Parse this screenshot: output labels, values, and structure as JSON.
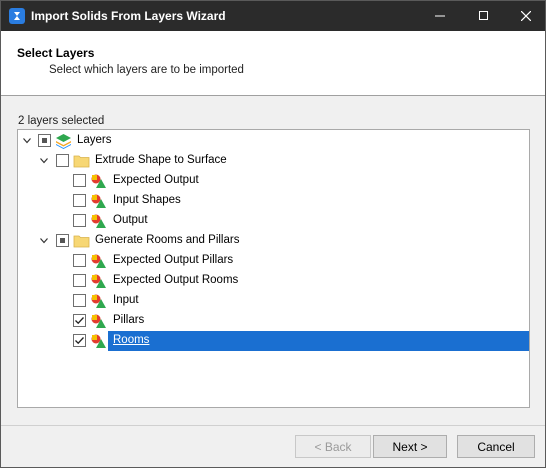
{
  "window": {
    "title": "Import Solids From Layers Wizard"
  },
  "header": {
    "title": "Select Layers",
    "subtitle": "Select which layers are to be imported"
  },
  "selection_count": "2 layers selected",
  "tree": {
    "root": {
      "label": "Layers",
      "state": "indeterminate",
      "expanded": true
    },
    "groups": [
      {
        "label": "Extrude Shape to Surface",
        "state": "unchecked",
        "expanded": true,
        "children": [
          {
            "label": "Expected Output",
            "checked": false
          },
          {
            "label": "Input Shapes",
            "checked": false
          },
          {
            "label": "Output",
            "checked": false
          }
        ]
      },
      {
        "label": "Generate Rooms and Pillars",
        "state": "indeterminate",
        "expanded": true,
        "children": [
          {
            "label": "Expected Output Pillars",
            "checked": false
          },
          {
            "label": "Expected Output Rooms",
            "checked": false
          },
          {
            "label": "Input",
            "checked": false
          },
          {
            "label": "Pillars",
            "checked": true
          },
          {
            "label": "Rooms",
            "checked": true,
            "selected": true
          }
        ]
      }
    ]
  },
  "buttons": {
    "back": "< Back",
    "next": "Next >",
    "cancel": "Cancel"
  },
  "colors": {
    "titlebar": "#2b2b2b",
    "selection": "#1a6fd1",
    "accent_icon": "#1e90ff"
  }
}
